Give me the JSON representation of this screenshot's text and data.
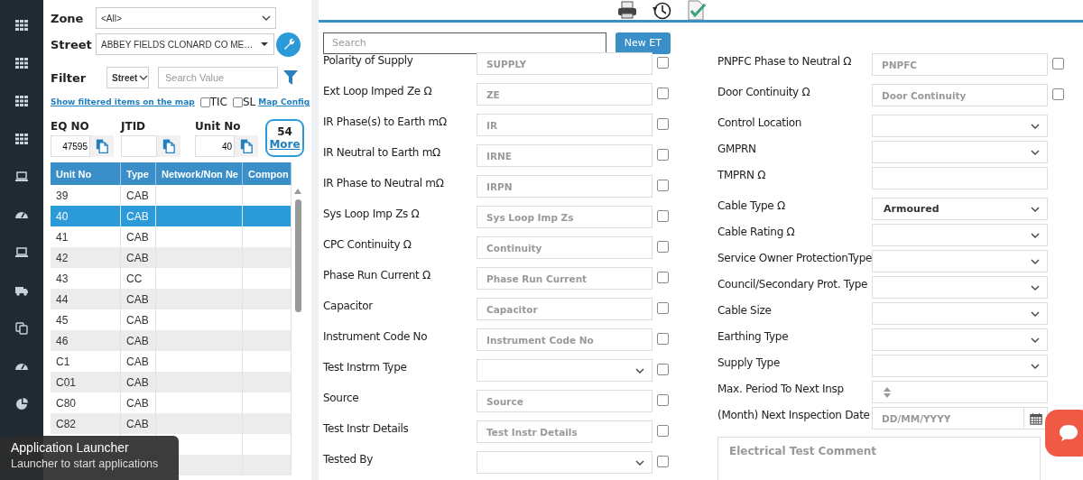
{
  "nav": [
    {
      "kind": "grid"
    },
    {
      "kind": "grid"
    },
    {
      "kind": "grid"
    },
    {
      "kind": "grid"
    },
    {
      "kind": "laptop"
    },
    {
      "kind": "gauge"
    },
    {
      "kind": "laptop"
    },
    {
      "kind": "truck"
    },
    {
      "kind": "copy"
    },
    {
      "kind": "gauge"
    },
    {
      "kind": "pie"
    }
  ],
  "filters": {
    "zone": {
      "label": "Zone",
      "value": "<All>"
    },
    "street": {
      "label": "Street",
      "value": "ABBEY FIELDS CLONARD CO ME…"
    },
    "filter": {
      "label": "Filter",
      "value": "Street",
      "placeholder": "Search Value"
    },
    "map_link": "Show filtered items on the map",
    "options": [
      {
        "label": "TIC",
        "checked": false
      },
      {
        "label": "SL",
        "checked": false
      }
    ],
    "config_link": "Map Config"
  },
  "ids": [
    {
      "label": "EQ NO",
      "value": "47595"
    },
    {
      "label": "JTID"
    },
    {
      "label": "Unit No",
      "value": "40"
    }
  ],
  "more": {
    "count": "54",
    "label": "More"
  },
  "table": {
    "columns": [
      "Unit No",
      "Type",
      "Network/Non Ne",
      "Compon"
    ],
    "rows": [
      {
        "cells": [
          "39",
          "CAB"
        ],
        "selected": false
      },
      {
        "cells": [
          "40",
          "CAB"
        ],
        "selected": true
      },
      {
        "cells": [
          "41",
          "CAB"
        ],
        "selected": false
      },
      {
        "cells": [
          "42",
          "CAB"
        ],
        "selected": false
      },
      {
        "cells": [
          "43",
          "CC"
        ],
        "selected": false
      },
      {
        "cells": [
          "44",
          "CAB"
        ],
        "selected": false
      },
      {
        "cells": [
          "45",
          "CAB"
        ],
        "selected": false
      },
      {
        "cells": [
          "46",
          "CAB"
        ],
        "selected": false
      },
      {
        "cells": [
          "C1",
          "CAB"
        ],
        "selected": false
      },
      {
        "cells": [
          "C01",
          "CAB"
        ],
        "selected": false
      },
      {
        "cells": [
          "C80",
          "CAB"
        ],
        "selected": false
      },
      {
        "cells": [
          "C82",
          "CAB"
        ],
        "selected": false
      }
    ]
  },
  "toolbar": [
    {
      "kind": "printer"
    },
    {
      "kind": "history"
    },
    {
      "kind": "doc-check"
    }
  ],
  "form": {
    "search": {
      "placeholder": "Search"
    },
    "button": "New ET",
    "left_fields": [
      {
        "label": "Polarity of Supply",
        "kind": "text",
        "placeholder": "SUPPLY",
        "checked": false
      },
      {
        "label": "Ext Loop Imped Ze Ω",
        "kind": "text",
        "placeholder": "ZE",
        "checked": false
      },
      {
        "label": "IR Phase(s) to Earth mΩ",
        "kind": "text",
        "placeholder": "IR",
        "checked": false
      },
      {
        "label": "IR Neutral to Earth mΩ",
        "kind": "text",
        "placeholder": "IRNE",
        "checked": false
      },
      {
        "label": "IR Phase to Neutral mΩ",
        "kind": "text",
        "placeholder": "IRPN",
        "checked": false
      },
      {
        "label": "Sys Loop Imp Zs Ω",
        "kind": "text",
        "placeholder": "Sys Loop Imp Zs",
        "checked": false
      },
      {
        "label": "CPC Continuity Ω",
        "kind": "text",
        "placeholder": "Continuity",
        "checked": false
      },
      {
        "label": "Phase Run Current Ω",
        "kind": "text",
        "placeholder": "Phase Run Current",
        "checked": false
      },
      {
        "label": "Capacitor",
        "kind": "text",
        "placeholder": "Capacitor",
        "checked": false
      },
      {
        "label": "Instrument Code No",
        "kind": "text",
        "placeholder": "Instrument Code No",
        "checked": false
      },
      {
        "label": "Test Instrm Type",
        "kind": "select",
        "checked": false
      },
      {
        "label": "Source",
        "kind": "text",
        "placeholder": "Source",
        "checked": false
      },
      {
        "label": "Test Instr Details",
        "kind": "text",
        "placeholder": "Test Instr Details",
        "checked": false
      },
      {
        "label": "Tested By",
        "kind": "select",
        "checked": false
      }
    ],
    "right_fields": [
      {
        "label": "PNPFC Phase to Neutral Ω",
        "kind": "text",
        "placeholder": "PNPFC",
        "checked": false
      },
      {
        "label": "Door Continuity Ω",
        "kind": "text",
        "placeholder": "Door Continuity",
        "checked": false
      },
      {
        "label": "Control Location",
        "kind": "select"
      },
      {
        "label": "GMPRN",
        "kind": "select"
      },
      {
        "label": "TMPRN Ω",
        "kind": "text"
      },
      {
        "label": "Cable Type Ω",
        "kind": "select",
        "value": "Armoured"
      },
      {
        "label": "Cable Rating Ω",
        "kind": "select"
      },
      {
        "label": "Service Owner ProtectionType",
        "kind": "select"
      },
      {
        "label": "Council/Secondary Prot. Type",
        "kind": "select"
      },
      {
        "label": "Cable Size",
        "kind": "select"
      },
      {
        "label": "Earthing Type",
        "kind": "select"
      },
      {
        "label": "Supply Type",
        "kind": "select"
      },
      {
        "label": "Max. Period To Next Insp",
        "kind": "number"
      },
      {
        "label": "(Month) Next Inspection Date",
        "kind": "date",
        "placeholder": "DD/MM/YYYY"
      }
    ],
    "comment": {
      "placeholder": "Electrical Test Comment"
    }
  },
  "tooltip": {
    "title": "Application Launcher",
    "text": "Launcher to start applications"
  }
}
